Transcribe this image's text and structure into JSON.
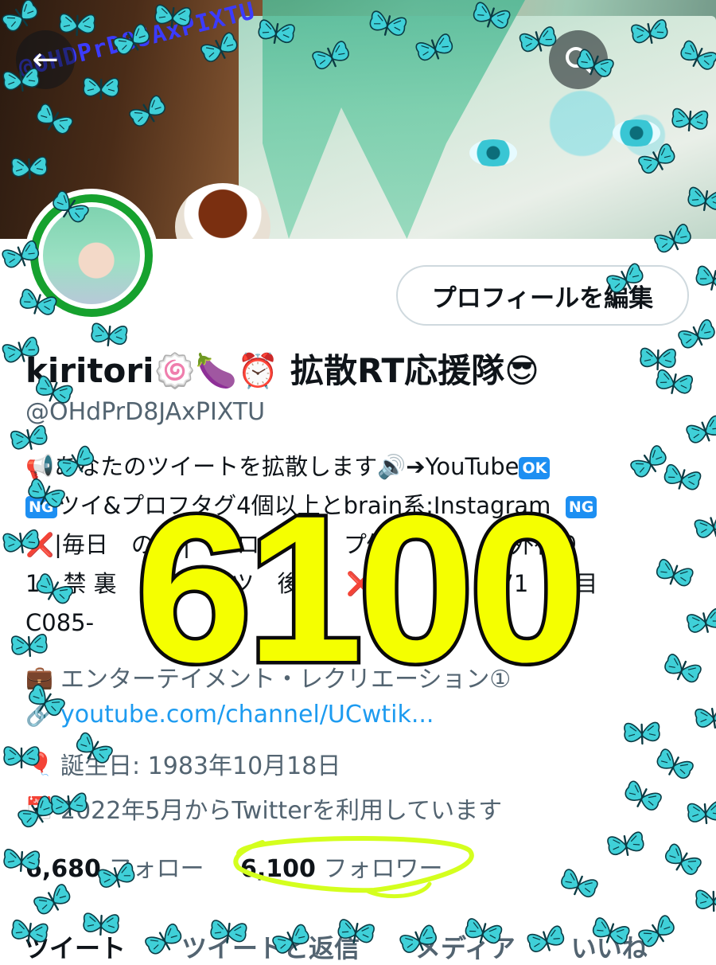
{
  "banner": {
    "watermark": "@OHDPrD8JAxPIXTU",
    "back_icon": "arrow-left-icon",
    "search_icon": "search-icon"
  },
  "profile": {
    "edit_button": "プロフィールを編集",
    "name": "kiritori🍥🍆⏰ 拡散RT応援隊😎",
    "handle": "@OHdPrD8JAxPIXTU",
    "bio_lines": [
      "📢あなたのツイートを拡散します🔊➔YouTube",
      "ツイ&プロフタグ4個以上とbrain系:Instagram",
      "❌|毎日　のRT|　プロ　　0　プ優　　👍　例外有り",
      "1　禁 裏　の　誅 0ツ　後　　❌|5　　1　▶71　　目",
      "C085-"
    ],
    "bio_badges": {
      "ok": "OK",
      "ng": "NG"
    },
    "category": "エンターテイメント・レクリエーション①",
    "website": "youtube.com/channel/UCwtik...",
    "birthday": "誕生日: 1983年10月18日",
    "joined": "2022年5月からTwitterを利用しています",
    "following_count": "6,680",
    "following_label": "フォロー",
    "followers_count": "6,100",
    "followers_label": "フォロワー"
  },
  "tabs": [
    "ツイート",
    "ツイートと返信",
    "メディア",
    "いいね"
  ],
  "overlay": {
    "big_number": "6100",
    "number_color": "#f5ff00",
    "circle_color": "#d4ff1e"
  },
  "colors": {
    "link": "#1d9bf0",
    "butterfly": "#3fd0d8"
  },
  "icons": {
    "category": "briefcase-icon",
    "website": "link-icon",
    "birthday": "balloon-icon",
    "joined": "calendar-icon"
  }
}
